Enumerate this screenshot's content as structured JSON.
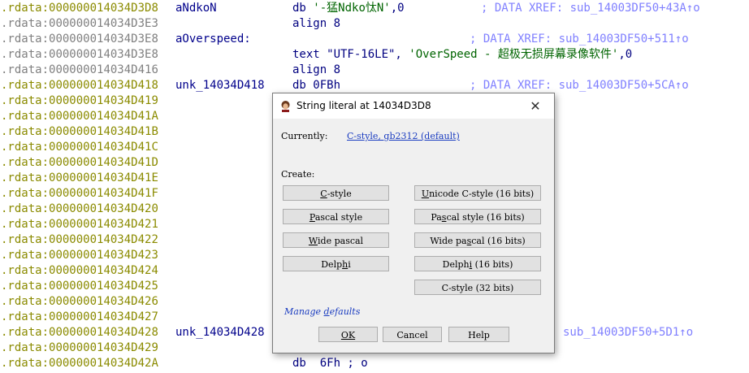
{
  "listing": [
    {
      "seg": ".rdata:",
      "addr": "000000014034D3D8",
      "label": "aNdkoN",
      "ins": "db ",
      "operand": "'-猛Ndko忲N'",
      "ins_tail": ",0",
      "comment": "; DATA XREF: sub_14003DF50+43A↑o",
      "hl": true
    },
    {
      "seg": ".rdata:",
      "addr": "000000014034D3E3",
      "label": "",
      "ins": "align 8",
      "operand": "",
      "ins_tail": "",
      "comment": "",
      "hl": false
    },
    {
      "seg": ".rdata:",
      "addr": "000000014034D3E8",
      "label": "aOverspeed:",
      "ins": "",
      "operand": "",
      "ins_tail": "",
      "comment": "; DATA XREF: sub_14003DF50+511↑o",
      "hl": false
    },
    {
      "seg": ".rdata:",
      "addr": "000000014034D3E8",
      "label": "",
      "ins": "text \"UTF-16LE\", ",
      "operand": "'OverSpeed - 超极无损屏幕录像软件'",
      "ins_tail": ",0",
      "comment": "",
      "hl": false
    },
    {
      "seg": ".rdata:",
      "addr": "000000014034D416",
      "label": "",
      "ins": "align 8",
      "operand": "",
      "ins_tail": "",
      "comment": "",
      "hl": false
    },
    {
      "seg": ".rdata:",
      "addr": "000000014034D418",
      "label": "unk_14034D418",
      "ins": "db 0FBh",
      "operand": "",
      "ins_tail": "",
      "comment": "; DATA XREF: sub_14003DF50+5CA↑o",
      "hl": true
    },
    {
      "seg": ".rdata:",
      "addr": "000000014034D419",
      "label": "",
      "ins": "",
      "operand": "",
      "ins_tail": "",
      "comment": "",
      "hl": true
    },
    {
      "seg": ".rdata:",
      "addr": "000000014034D41A",
      "label": "",
      "ins": "",
      "operand": "",
      "ins_tail": "",
      "comment": "",
      "hl": true
    },
    {
      "seg": ".rdata:",
      "addr": "000000014034D41B",
      "label": "",
      "ins": "",
      "operand": "",
      "ins_tail": "",
      "comment": "",
      "hl": true
    },
    {
      "seg": ".rdata:",
      "addr": "000000014034D41C",
      "label": "",
      "ins": "",
      "operand": "",
      "ins_tail": "",
      "comment": "",
      "hl": true
    },
    {
      "seg": ".rdata:",
      "addr": "000000014034D41D",
      "label": "",
      "ins": "",
      "operand": "",
      "ins_tail": "",
      "comment": "",
      "hl": true
    },
    {
      "seg": ".rdata:",
      "addr": "000000014034D41E",
      "label": "",
      "ins": "",
      "operand": "",
      "ins_tail": "",
      "comment": "",
      "hl": true
    },
    {
      "seg": ".rdata:",
      "addr": "000000014034D41F",
      "label": "",
      "ins": "",
      "operand": "",
      "ins_tail": "",
      "comment": "",
      "hl": true
    },
    {
      "seg": ".rdata:",
      "addr": "000000014034D420",
      "label": "",
      "ins": "",
      "operand": "",
      "ins_tail": "",
      "comment": "",
      "hl": true
    },
    {
      "seg": ".rdata:",
      "addr": "000000014034D421",
      "label": "",
      "ins": "",
      "operand": "",
      "ins_tail": "",
      "comment": "",
      "hl": true
    },
    {
      "seg": ".rdata:",
      "addr": "000000014034D422",
      "label": "",
      "ins": "",
      "operand": "",
      "ins_tail": "",
      "comment": "",
      "hl": true
    },
    {
      "seg": ".rdata:",
      "addr": "000000014034D423",
      "label": "",
      "ins": "",
      "operand": "",
      "ins_tail": "",
      "comment": "",
      "hl": true
    },
    {
      "seg": ".rdata:",
      "addr": "000000014034D424",
      "label": "",
      "ins": "",
      "operand": "",
      "ins_tail": "",
      "comment": "",
      "hl": true
    },
    {
      "seg": ".rdata:",
      "addr": "000000014034D425",
      "label": "",
      "ins": "",
      "operand": "",
      "ins_tail": "",
      "comment": "",
      "hl": true
    },
    {
      "seg": ".rdata:",
      "addr": "000000014034D426",
      "label": "",
      "ins": "",
      "operand": "",
      "ins_tail": "",
      "comment": "",
      "hl": true
    },
    {
      "seg": ".rdata:",
      "addr": "000000014034D427",
      "label": "",
      "ins": "",
      "operand": "",
      "ins_tail": "",
      "comment": "",
      "hl": true
    },
    {
      "seg": ".rdata:",
      "addr": "000000014034D428",
      "label": "unk_14034D428",
      "ins": "",
      "operand": "",
      "ins_tail": "",
      "comment": "sub_14003DF50+5D1↑o",
      "hl": true
    },
    {
      "seg": ".rdata:",
      "addr": "000000014034D429",
      "label": "",
      "ins": "",
      "operand": "",
      "ins_tail": "",
      "comment": "",
      "hl": true
    },
    {
      "seg": ".rdata:",
      "addr": "000000014034D42A",
      "label": "",
      "ins": "db  6Fh ; o",
      "operand": "",
      "ins_tail": "",
      "comment": "",
      "hl": true
    }
  ],
  "dialog": {
    "title": "String literal at 14034D3D8",
    "close_glyph": "✕",
    "currently_label": "Currently:",
    "currently_value": "C-style, gb2312 (default)",
    "create_label": "Create:",
    "buttons_left": [
      {
        "pre": "",
        "key": "C",
        "post": "-style"
      },
      {
        "pre": "",
        "key": "P",
        "post": "ascal style"
      },
      {
        "pre": "",
        "key": "W",
        "post": "ide pascal"
      },
      {
        "pre": "Delp",
        "key": "h",
        "post": "i"
      }
    ],
    "buttons_right": [
      {
        "pre": "",
        "key": "U",
        "post": "nicode C-style (16 bits)"
      },
      {
        "pre": "Pa",
        "key": "s",
        "post": "cal style (16 bits)"
      },
      {
        "pre": "Wide pa",
        "key": "s",
        "post": "cal (16 bits)"
      },
      {
        "pre": "Delph",
        "key": "i",
        "post": " (16 bits)"
      },
      {
        "pre": "C-style (32 bits)",
        "key": "",
        "post": ""
      }
    ],
    "manage_pre": "Manage ",
    "manage_key": "d",
    "manage_post": "efaults",
    "ok_label": "OK",
    "cancel_label": "Cancel",
    "help_label": "Help"
  }
}
